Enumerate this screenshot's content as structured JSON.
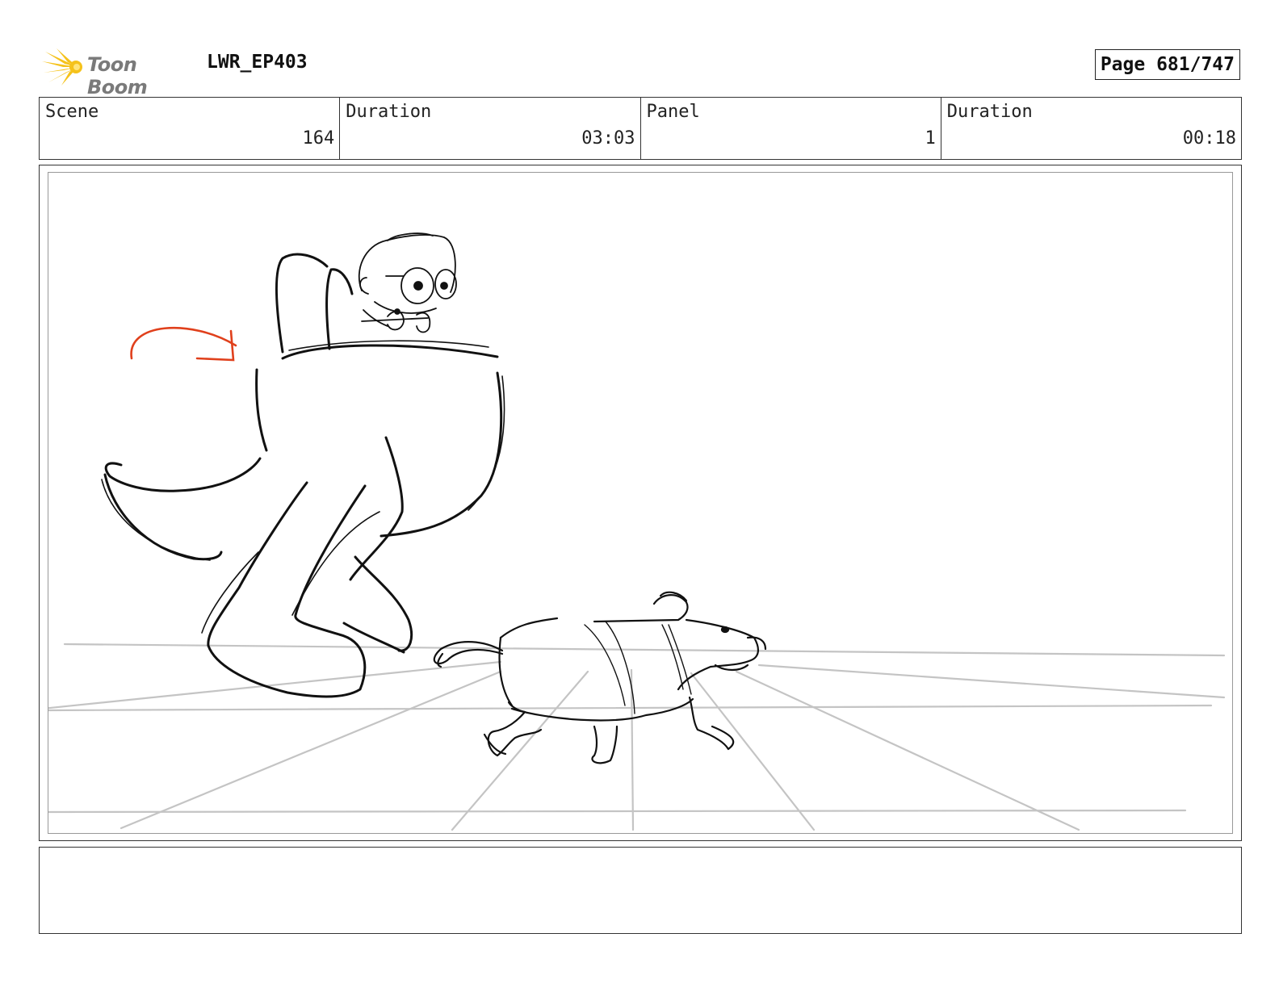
{
  "header": {
    "logo_text": "Toon Boom",
    "project": "LWR_EP403",
    "page": "Page 681/747"
  },
  "info": {
    "scene_label": "Scene",
    "scene_value": "164",
    "scene_duration_label": "Duration",
    "scene_duration_value": "03:03",
    "panel_label": "Panel",
    "panel_value": "1",
    "panel_duration_label": "Duration",
    "panel_duration_value": "00:18"
  },
  "colors": {
    "logo_burst": "#f5c21b",
    "logo_text": "#7a7a7a",
    "sketch": "#111111",
    "perspective": "#c4c4c4",
    "arrow": "#e0401c"
  },
  "notes": {
    "text": ""
  }
}
